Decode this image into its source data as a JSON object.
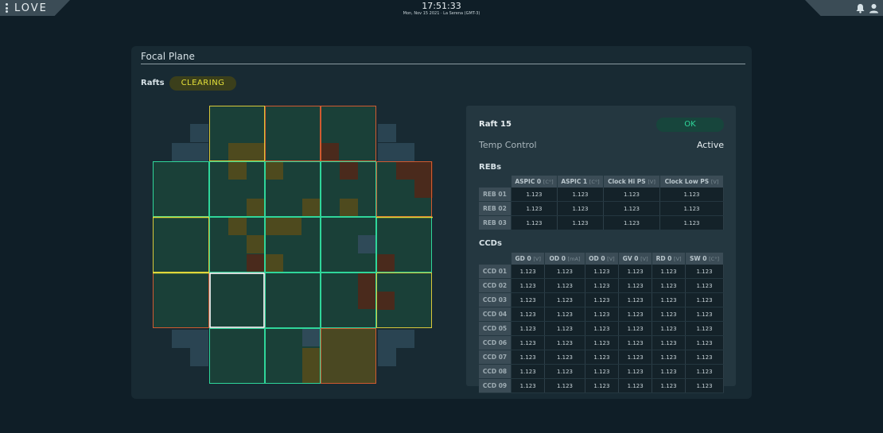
{
  "app": {
    "title": "LOVE"
  },
  "clock": {
    "time": "17:51:33",
    "date": "Mon, Nov 15 2021 · La Serena (GMT-3)"
  },
  "icons": {
    "menu": "menu-icon",
    "bell": "bell-icon",
    "user": "user-icon"
  },
  "panel": {
    "title": "Focal Plane"
  },
  "rafts": {
    "label": "Rafts",
    "state": "CLEARING",
    "state_color": "#e4e03a"
  },
  "raft": {
    "name": "Raft 15",
    "status": "OK",
    "status_color": "#2fd69a",
    "temp_label": "Temp Control",
    "temp_value": "Active"
  },
  "colors": {
    "ok": "#2fd69a",
    "warning": "#d8c83a",
    "alarm": "#d05a30",
    "selected": "#ffffff",
    "cell_ok": "#1b4a3e",
    "cell_warning": "#4e4a1e",
    "cell_alarm": "#4a2a1c"
  },
  "rebs": {
    "title": "REBs",
    "headers": [
      {
        "name": "ASPIC 0",
        "unit": "[C°]"
      },
      {
        "name": "ASPIC 1",
        "unit": "[C°]"
      },
      {
        "name": "Clock Hi PS",
        "unit": "[V]"
      },
      {
        "name": "Clock Low PS",
        "unit": "[V]"
      }
    ],
    "rows": [
      {
        "label": "REB 01",
        "values": [
          "1.123",
          "1.123",
          "1.123",
          "1.123"
        ]
      },
      {
        "label": "REB 02",
        "values": [
          "1.123",
          "1.123",
          "1.123",
          "1.123"
        ]
      },
      {
        "label": "REB 03",
        "values": [
          "1.123",
          "1.123",
          "1.123",
          "1.123"
        ]
      }
    ]
  },
  "ccds": {
    "title": "CCDs",
    "headers": [
      {
        "name": "GD 0",
        "unit": "[V]"
      },
      {
        "name": "OD 0",
        "unit": "[mA]"
      },
      {
        "name": "OD 0",
        "unit": "[V]"
      },
      {
        "name": "GV 0",
        "unit": "[V]"
      },
      {
        "name": "RD 0",
        "unit": "[V]"
      },
      {
        "name": "SW 0",
        "unit": "[C°]"
      }
    ],
    "rows": [
      {
        "label": "CCD 01",
        "values": [
          "1.123",
          "1.123",
          "1.123",
          "1.123",
          "1.123",
          "1.123"
        ]
      },
      {
        "label": "CCD 02",
        "values": [
          "1.123",
          "1.123",
          "1.123",
          "1.123",
          "1.123",
          "1.123"
        ]
      },
      {
        "label": "CCD 03",
        "values": [
          "1.123",
          "1.123",
          "1.123",
          "1.123",
          "1.123",
          "1.123"
        ]
      },
      {
        "label": "CCD 04",
        "values": [
          "1.123",
          "1.123",
          "1.123",
          "1.123",
          "1.123",
          "1.123"
        ]
      },
      {
        "label": "CCD 05",
        "values": [
          "1.123",
          "1.123",
          "1.123",
          "1.123",
          "1.123",
          "1.123"
        ]
      },
      {
        "label": "CCD 06",
        "values": [
          "1.123",
          "1.123",
          "1.123",
          "1.123",
          "1.123",
          "1.123"
        ]
      },
      {
        "label": "CCD 07",
        "values": [
          "1.123",
          "1.123",
          "1.123",
          "1.123",
          "1.123",
          "1.123"
        ]
      },
      {
        "label": "CCD 08",
        "values": [
          "1.123",
          "1.123",
          "1.123",
          "1.123",
          "1.123",
          "1.123"
        ]
      },
      {
        "label": "CCD 09",
        "values": [
          "1.123",
          "1.123",
          "1.123",
          "1.123",
          "1.123",
          "1.123"
        ]
      }
    ]
  }
}
